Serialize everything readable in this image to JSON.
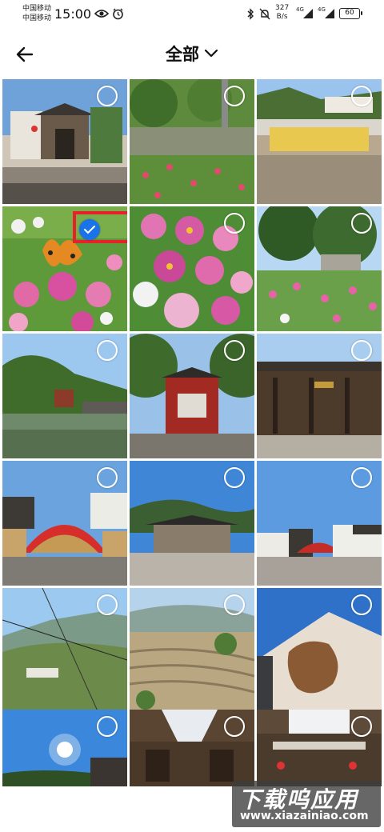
{
  "status_bar": {
    "carrier_1": "中国移动",
    "carrier_2": "中国移动",
    "time": "15:00",
    "net_speed_value": "327",
    "net_speed_unit": "B/s",
    "signal_label_1": "4G",
    "signal_label_2": "4G",
    "battery": "60"
  },
  "header": {
    "title": "全部",
    "back_icon": "arrow-left-icon",
    "dropdown_icon": "chevron-down-icon"
  },
  "photos": [
    {
      "subject": "ancient-gate-courtyard",
      "selected": false
    },
    {
      "subject": "garden-path-flowers",
      "selected": false
    },
    {
      "subject": "stone-plaza-sign",
      "selected": false
    },
    {
      "subject": "butterfly-on-cosmos",
      "selected": true
    },
    {
      "subject": "pink-cosmos-flowers",
      "selected": false
    },
    {
      "subject": "flower-field-trees",
      "selected": false
    },
    {
      "subject": "pond-pavilion",
      "selected": false
    },
    {
      "subject": "red-opera-stage",
      "selected": false
    },
    {
      "subject": "ancestral-hall-interior",
      "selected": false
    },
    {
      "subject": "red-fan-sculpture",
      "selected": false
    },
    {
      "subject": "village-square",
      "selected": false
    },
    {
      "subject": "village-square-wide",
      "selected": false
    },
    {
      "subject": "cable-line-mountains",
      "selected": false
    },
    {
      "subject": "terraced-hillside",
      "selected": false
    },
    {
      "subject": "map-wall-relief",
      "selected": false
    },
    {
      "subject": "sun-sky",
      "selected": false
    },
    {
      "subject": "courtyard-interior-1",
      "selected": false
    },
    {
      "subject": "courtyard-interior-2",
      "selected": false
    }
  ],
  "watermark": {
    "title": "下载呜应用",
    "url": "www.xiazainiao.com"
  },
  "colors": {
    "selected_accent": "#1a73e8",
    "highlight_box": "#e8202a"
  }
}
